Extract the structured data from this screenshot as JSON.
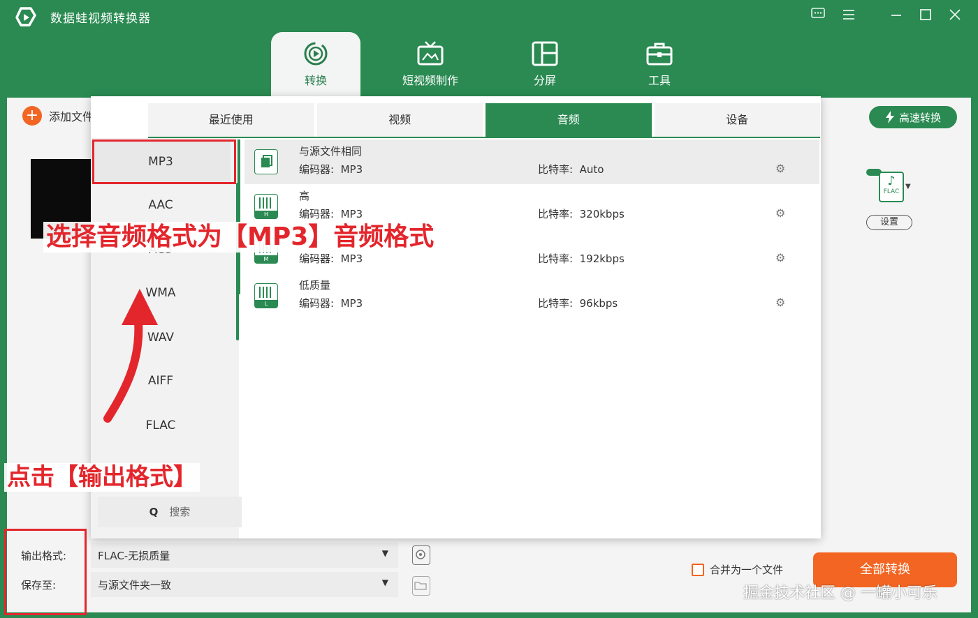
{
  "app": {
    "title": "数据蛙视频转换器",
    "window_controls": [
      "feedback-icon",
      "menu-icon",
      "minimize-icon",
      "maximize-icon",
      "close-icon"
    ]
  },
  "main_tabs": [
    {
      "label": "转换",
      "icon": "convert-icon",
      "active": true
    },
    {
      "label": "短视频制作",
      "icon": "tv-icon",
      "active": false
    },
    {
      "label": "分屏",
      "icon": "split-screen-icon",
      "active": false
    },
    {
      "label": "工具",
      "icon": "toolbox-icon",
      "active": false
    }
  ],
  "toolbar": {
    "add_file_label": "添加文件",
    "speed_label": "高速转换"
  },
  "right_panel": {
    "format_badge": "FLAC",
    "settings_label": "设置"
  },
  "popup": {
    "tabs": [
      "最近使用",
      "视频",
      "音频",
      "设备"
    ],
    "active_tab": "音频",
    "formats": [
      "MP3",
      "AAC",
      "AC3",
      "WMA",
      "WAV",
      "AIFF",
      "FLAC"
    ],
    "selected_format": "MP3",
    "search_label": "搜索",
    "codec_label": "编码器:",
    "bitrate_label": "比特率:",
    "presets": [
      {
        "name": "与源文件相同",
        "codec": "MP3",
        "bitrate": "Auto",
        "badge": ""
      },
      {
        "name": "高",
        "codec": "MP3",
        "bitrate": "320kbps",
        "badge": "H"
      },
      {
        "name": "中",
        "codec": "MP3",
        "bitrate": "192kbps",
        "badge": "M"
      },
      {
        "name": "低质量",
        "codec": "MP3",
        "bitrate": "96kbps",
        "badge": "L"
      }
    ]
  },
  "bottom": {
    "output_format_label": "输出格式:",
    "output_format_value": "FLAC-无损质量",
    "save_to_label": "保存至:",
    "save_to_value": "与源文件夹一致",
    "merge_label": "合并为一个文件",
    "convert_all_label": "全部转换"
  },
  "annotations": {
    "select_mp3": "选择音频格式为【MP3】音频格式",
    "click_output": "点击【输出格式】"
  },
  "watermark": "掘金技术社区 @ 一罐小可乐",
  "colors": {
    "brand_green": "#2a8a52",
    "accent_orange": "#f26522",
    "annotation_red": "#e3262c"
  }
}
